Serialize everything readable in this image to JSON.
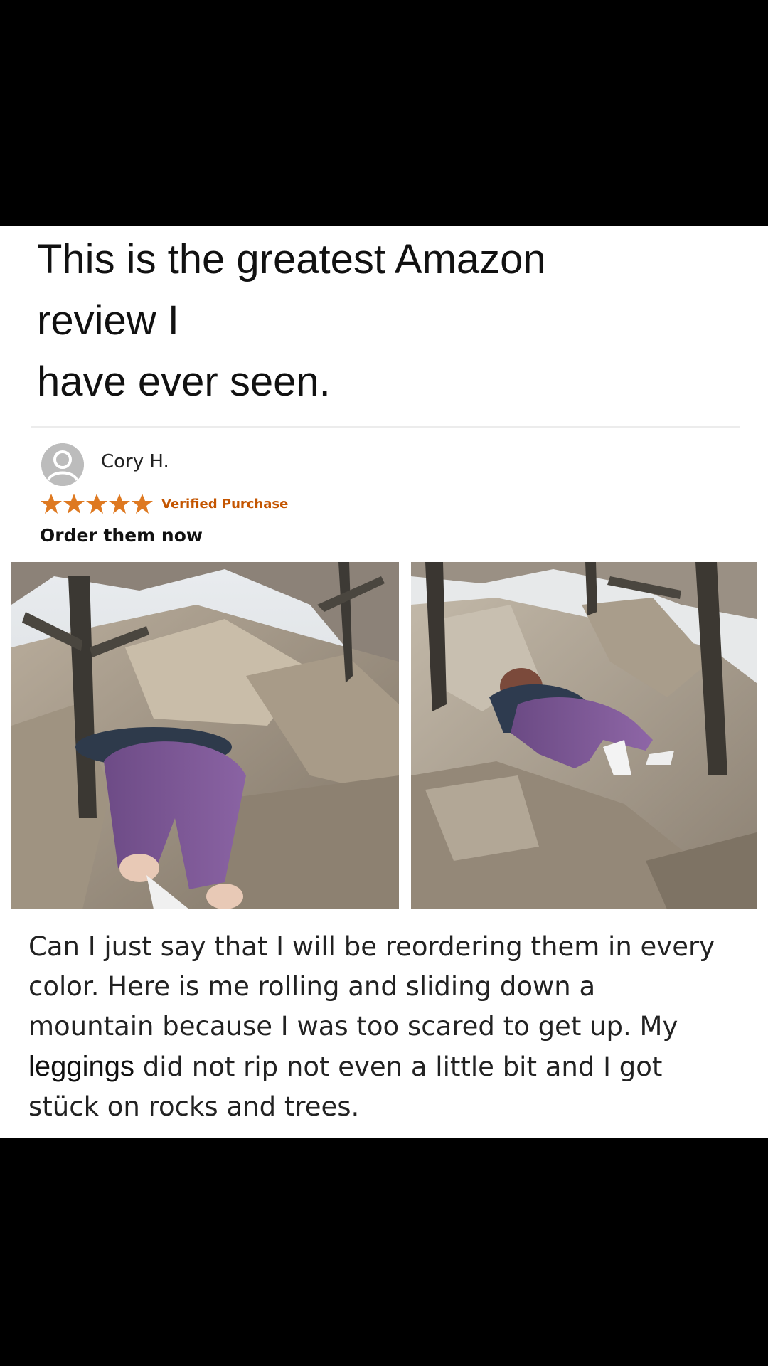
{
  "headline": {
    "lines": [
      "This is the greatest Amazon",
      "review I",
      "have ever seen."
    ]
  },
  "review": {
    "reviewer": "Cory H.",
    "avatar_icon": "user-silhouette-icon",
    "rating": 5,
    "rating_max": 5,
    "star_color": "#de7921",
    "badge": "Verified Purchase",
    "badge_color": "#c45500",
    "title": "Order them now",
    "photos": [
      {
        "icon": "review-photo-1"
      },
      {
        "icon": "review-photo-2"
      }
    ],
    "body_lines": [
      {
        "pre": "Can I just say that I will be reordering them in every",
        "emph": "",
        "post": ""
      },
      {
        "pre": "color. Here is me rolling and sliding down a",
        "emph": "",
        "post": ""
      },
      {
        "pre": "mountain because I was too scared to get up. My",
        "emph": "",
        "post": ""
      },
      {
        "pre": "",
        "emph": "leggings",
        "post": " did not rip not even a little bit and I got"
      },
      {
        "pre": "stück on rocks and trees.",
        "emph": "",
        "post": ""
      }
    ]
  }
}
